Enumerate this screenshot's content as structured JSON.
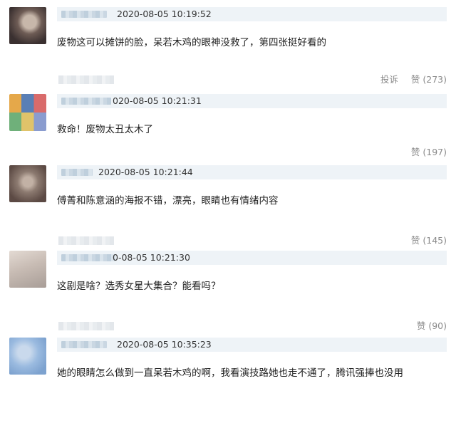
{
  "comments": [
    {
      "timestamp": "2020-08-05 10:19:52",
      "text": "废物这可以摊饼的脸，呆若木鸡的眼神没救了，第四张挺好看的",
      "report": "投诉",
      "like": "赞 (273)",
      "avatar_colors": [
        "#3a3030",
        "#6e5c55",
        "#c7b7aa"
      ]
    },
    {
      "timestamp": "020-08-05 10:21:31",
      "text": "救命！废物太丑太木了",
      "like": "赞 (197)",
      "avatar_colors": [
        "#e5a84a",
        "#5a7fb5",
        "#d96b6b"
      ]
    },
    {
      "timestamp": "2020-08-05 10:21:44",
      "text": "傅菁和陈意涵的海报不错，漂亮，眼睛也有情绪内容",
      "like": "赞 (145)",
      "avatar_colors": [
        "#5c4a44",
        "#8c7a70",
        "#c2b1a5"
      ]
    },
    {
      "timestamp": "0-08-05 10:21:30",
      "text": "这剧是啥？选秀女星大集合？能看吗？",
      "like": "赞 (90)",
      "avatar_colors": [
        "#a89d97",
        "#c8bcb4",
        "#e3dad3"
      ]
    },
    {
      "timestamp": "2020-08-05 10:35:23",
      "text": "她的眼睛怎么做到一直呆若木鸡的啊，我看演技路她也走不通了，腾讯强捧也没用",
      "avatar_colors": [
        "#7da2cf",
        "#9bbbe0",
        "#c9d9ec"
      ]
    }
  ]
}
